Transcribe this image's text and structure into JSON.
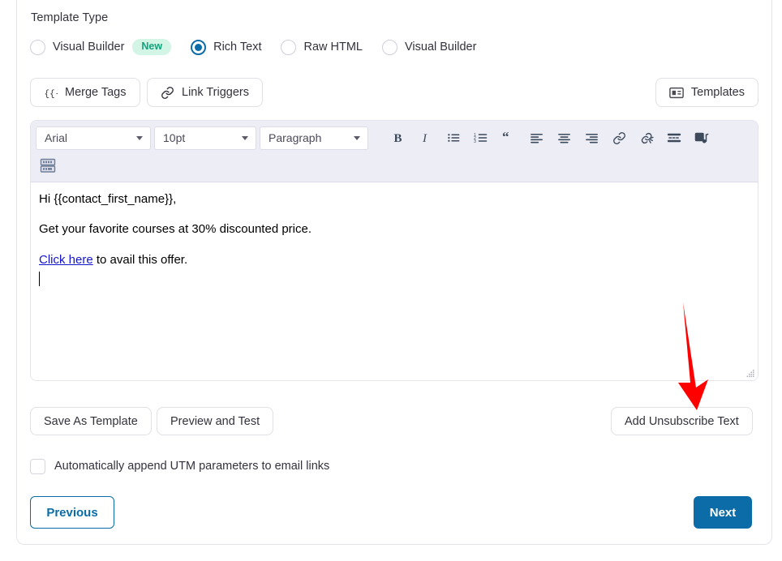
{
  "template_type": {
    "label": "Template Type",
    "options": [
      {
        "label": "Visual Builder",
        "selected": false,
        "badge": "New"
      },
      {
        "label": "Rich Text",
        "selected": true
      },
      {
        "label": "Raw HTML",
        "selected": false
      },
      {
        "label": "Visual Builder",
        "selected": false
      }
    ]
  },
  "actions": {
    "merge_tags": "Merge Tags",
    "link_triggers": "Link Triggers",
    "templates": "Templates"
  },
  "editor": {
    "font_family": "Arial",
    "font_size": "10pt",
    "format": "Paragraph",
    "toolbar_icons": [
      "bold-icon",
      "italic-icon",
      "bullet-list-icon",
      "numbered-list-icon",
      "blockquote-icon",
      "align-left-icon",
      "align-center-icon",
      "align-right-icon",
      "insert-link-icon",
      "unlink-icon",
      "horizontal-rule-icon",
      "insert-media-icon",
      "source-code-icon"
    ],
    "content": {
      "line1": "Hi {{contact_first_name}},",
      "line2": "Get your favorite courses at 30% discounted price.",
      "line3_link": "Click here",
      "line3_rest": " to avail this offer."
    }
  },
  "footer": {
    "save_as_template": "Save As Template",
    "preview_and_test": "Preview and Test",
    "add_unsubscribe_text": "Add Unsubscribe Text",
    "utm_checkbox_label": "Automatically append UTM parameters to email links",
    "utm_checked": false,
    "previous": "Previous",
    "next": "Next"
  },
  "colors": {
    "accent": "#0c6ca8",
    "badge_bg": "#d3f5e6",
    "badge_text": "#14a27c",
    "toolbar_bg": "#ededf6",
    "annotation_arrow": "#fe0000",
    "editor_link": "#1414cf"
  }
}
